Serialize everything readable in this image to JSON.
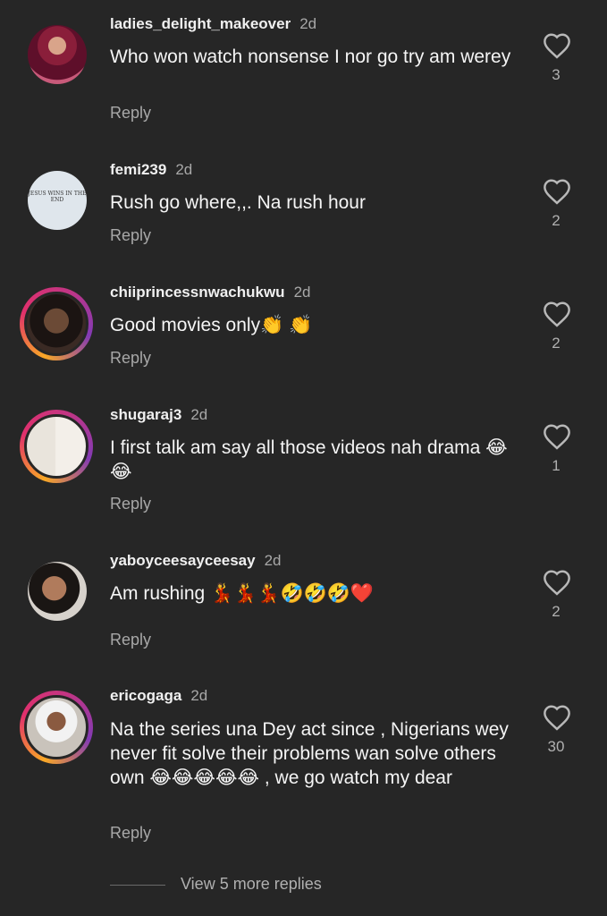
{
  "comments": [
    {
      "username": "ladies_delight_makeover",
      "time": "2d",
      "text": "Who won watch nonsense I nor go try am werey",
      "reply": "Reply",
      "likes": "3",
      "avatar_icon": "profile-photo"
    },
    {
      "username": "femi239",
      "time": "2d",
      "text": "Rush go where,,. Na rush hour",
      "reply": "Reply",
      "likes": "2",
      "avatar_icon": "profile-photo",
      "avatar_text": "JESUS WINS IN THE END"
    },
    {
      "username": "chiiprincessnwachukwu",
      "time": "2d",
      "text": "Good movies only👏 👏",
      "reply": "Reply",
      "likes": "2",
      "avatar_icon": "profile-photo"
    },
    {
      "username": "shugaraj3",
      "time": "2d",
      "text": "I first talk am say all those videos nah drama 😂😂",
      "reply": "Reply",
      "likes": "1",
      "avatar_icon": "profile-photo"
    },
    {
      "username": "yaboyceesayceesay",
      "time": "2d",
      "text": "Am rushing 💃💃💃🤣🤣🤣❤️",
      "reply": "Reply",
      "likes": "2",
      "avatar_icon": "profile-photo"
    },
    {
      "username": "ericogaga",
      "time": "2d",
      "text": "Na the  series una Dey act since , Nigerians wey never fit solve their problems wan solve others own 😂😂😂😂😂 , we go watch my dear",
      "reply": "Reply",
      "likes": "30",
      "avatar_icon": "profile-photo"
    }
  ],
  "view_more": "View 5 more replies",
  "colors": {
    "background": "#262626",
    "secondary_text": "#a8a8a8",
    "story_ring": [
      "#f9a826",
      "#e1306c",
      "#833ab4"
    ]
  }
}
